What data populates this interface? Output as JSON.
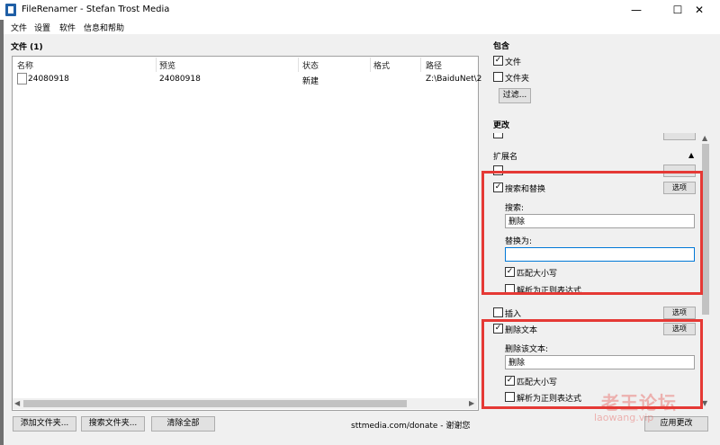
{
  "window": {
    "title": "FileRenamer - Stefan Trost Media",
    "min_glyph": "—",
    "max_glyph": "☐",
    "close_glyph": "✕"
  },
  "menu": [
    "文件",
    "设置",
    "软件",
    "信息和帮助"
  ],
  "files_section": {
    "title": "文件 (1)"
  },
  "table": {
    "columns": [
      "名称",
      "预览",
      "状态",
      "格式",
      "路径"
    ],
    "rows": [
      {
        "name": "24080918",
        "preview": "24080918",
        "status": "新建",
        "format": "",
        "path": "Z:\\BaiduNet\\2"
      }
    ]
  },
  "bottom": {
    "add_folder": "添加文件夹...",
    "search_folder": "搜索文件夹...",
    "clear_all": "清除全部",
    "donate": "sttmedia.com/donate - 谢谢您",
    "apply": "应用更改"
  },
  "include": {
    "title": "包含",
    "files": {
      "label": "文件",
      "checked": true
    },
    "folders": {
      "label": "文件夹",
      "checked": false
    },
    "filter_button": "过滤..."
  },
  "change": {
    "title": "更改",
    "extension_header": "扩展名",
    "collapse_arrow": "▲",
    "search_replace": {
      "label": "搜索和替换",
      "checked": true,
      "options": "选项",
      "search_label": "搜索:",
      "search_value": "删除",
      "replace_label": "替换为:",
      "replace_value": "",
      "match_case": {
        "label": "匹配大小写",
        "checked": true
      },
      "regex": {
        "label": "解析为正则表达式",
        "checked": false
      }
    },
    "insert": {
      "label": "插入",
      "checked": false,
      "options": "选项"
    },
    "delete_text": {
      "label": "删除文本",
      "checked": true,
      "options": "选项",
      "text_label": "删除该文本:",
      "text_value": "删除",
      "match_case": {
        "label": "匹配大小写",
        "checked": true
      },
      "regex": {
        "label": "解析为正则表达式",
        "checked": false
      }
    }
  },
  "watermark": {
    "text": "老王论坛",
    "sub": "laowang.vip"
  },
  "colors": {
    "highlight": "#e53935",
    "accent": "#0078d7",
    "icon": "#1f5fa6"
  },
  "icons": {
    "checkmark": "✓",
    "arrow_left": "◀",
    "arrow_right": "▶",
    "arrow_up": "▲",
    "arrow_down": "▼"
  }
}
